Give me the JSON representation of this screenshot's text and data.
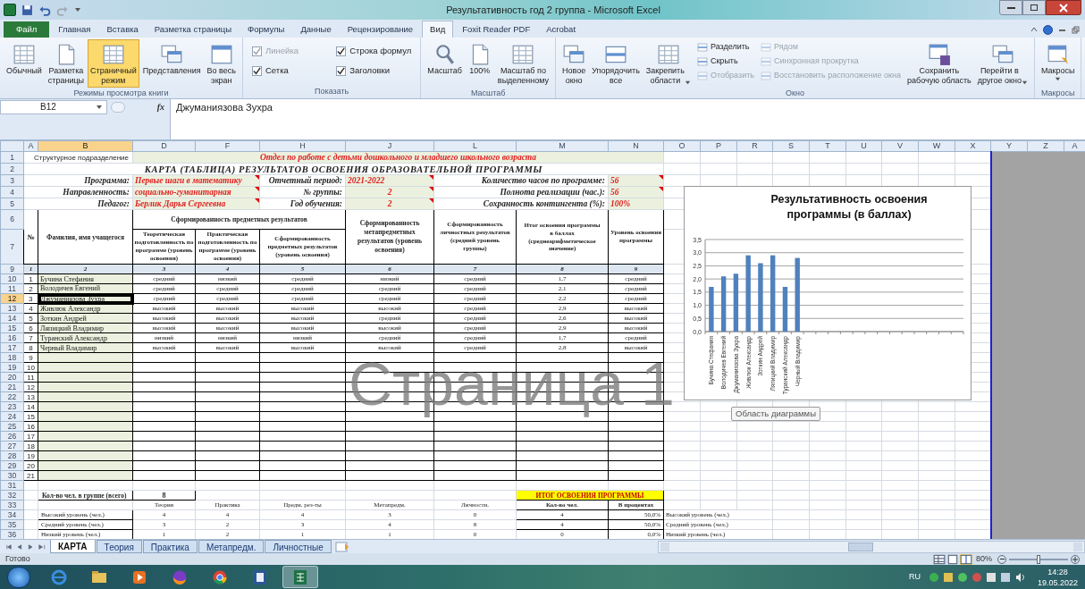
{
  "title_bar": {
    "title": "Результативность год 2 группа  -  Microsoft Excel"
  },
  "ribbon_tabs": [
    {
      "label": "Файл",
      "kind": "file",
      "selected": false
    },
    {
      "label": "Главная",
      "kind": "tab",
      "selected": false
    },
    {
      "label": "Вставка",
      "kind": "tab",
      "selected": false
    },
    {
      "label": "Разметка страницы",
      "kind": "tab",
      "selected": false
    },
    {
      "label": "Формулы",
      "kind": "tab",
      "selected": false
    },
    {
      "label": "Данные",
      "kind": "tab",
      "selected": false
    },
    {
      "label": "Рецензирование",
      "kind": "tab",
      "selected": false
    },
    {
      "label": "Вид",
      "kind": "tab",
      "selected": true
    },
    {
      "label": "Foxit Reader PDF",
      "kind": "tab",
      "selected": false
    },
    {
      "label": "Acrobat",
      "kind": "tab",
      "selected": false
    }
  ],
  "ribbon_groups": [
    {
      "label": "Режимы просмотра книги",
      "items": [
        {
          "kind": "large",
          "lines": [
            "Обычный"
          ],
          "selected": false,
          "disabled": false,
          "dropdown": false
        },
        {
          "kind": "large",
          "lines": [
            "Разметка",
            "страницы"
          ],
          "selected": false,
          "disabled": false,
          "dropdown": false
        },
        {
          "kind": "large",
          "lines": [
            "Страничный",
            "режим"
          ],
          "selected": true,
          "disabled": false,
          "dropdown": false
        },
        {
          "kind": "large",
          "lines": [
            "Представления"
          ],
          "selected": false,
          "disabled": false,
          "dropdown": false
        },
        {
          "kind": "large",
          "lines": [
            "Во весь",
            "экран"
          ],
          "selected": false,
          "disabled": false,
          "dropdown": false
        }
      ]
    },
    {
      "label": "Показать",
      "items": [
        {
          "kind": "check",
          "lines": [
            "Линейка"
          ],
          "checked": true,
          "disabled": true
        },
        {
          "kind": "check",
          "lines": [
            "Строка формул"
          ],
          "checked": true,
          "disabled": false
        },
        {
          "kind": "check",
          "lines": [
            "Сетка"
          ],
          "checked": true,
          "disabled": false
        },
        {
          "kind": "check",
          "lines": [
            "Заголовки"
          ],
          "checked": true,
          "disabled": false
        }
      ]
    },
    {
      "label": "Масштаб",
      "items": [
        {
          "kind": "large",
          "lines": [
            "Масштаб"
          ],
          "selected": false,
          "disabled": false,
          "dropdown": false
        },
        {
          "kind": "large",
          "lines": [
            "100%"
          ],
          "selected": false,
          "disabled": false,
          "dropdown": false
        },
        {
          "kind": "large",
          "lines": [
            "Масштаб по",
            "выделенному"
          ],
          "selected": false,
          "disabled": false,
          "dropdown": false
        }
      ]
    },
    {
      "label": "Окно",
      "items": [
        {
          "kind": "large",
          "lines": [
            "Новое",
            "окно"
          ],
          "selected": false,
          "disabled": false,
          "dropdown": false
        },
        {
          "kind": "large",
          "lines": [
            "Упорядочить",
            "все"
          ],
          "selected": false,
          "disabled": false,
          "dropdown": false
        },
        {
          "kind": "large",
          "lines": [
            "Закрепить",
            "области"
          ],
          "selected": false,
          "disabled": false,
          "dropdown": true
        },
        {
          "kind": "small",
          "lines": [
            "Разделить"
          ],
          "disabled": false
        },
        {
          "kind": "small",
          "lines": [
            "Скрыть"
          ],
          "disabled": false
        },
        {
          "kind": "small",
          "lines": [
            "Отобразить"
          ],
          "disabled": true
        },
        {
          "kind": "small",
          "lines": [
            "Рядом"
          ],
          "disabled": true
        },
        {
          "kind": "small",
          "lines": [
            "Синхронная прокрутка"
          ],
          "disabled": true
        },
        {
          "kind": "small",
          "lines": [
            "Восстановить расположение окна"
          ],
          "disabled": true
        },
        {
          "kind": "large",
          "lines": [
            "Сохранить",
            "рабочую область"
          ],
          "selected": false,
          "disabled": false,
          "dropdown": false
        },
        {
          "kind": "large",
          "lines": [
            "Перейти в",
            "другое окно"
          ],
          "selected": false,
          "disabled": false,
          "dropdown": true
        }
      ]
    },
    {
      "label": "Макросы",
      "items": [
        {
          "kind": "large",
          "lines": [
            "Макросы"
          ],
          "selected": false,
          "disabled": false,
          "dropdown": true
        }
      ]
    }
  ],
  "formula_bar": {
    "name_box": "B12",
    "fx_label": "fx",
    "formula": "Джуманиязова Зухра"
  },
  "columns": [
    {
      "label": "A",
      "selected": false
    },
    {
      "label": "B",
      "selected": true
    },
    {
      "label": "D",
      "selected": false
    },
    {
      "label": "F",
      "selected": false
    },
    {
      "label": "H",
      "selected": false
    },
    {
      "label": "J",
      "selected": false
    },
    {
      "label": "L",
      "selected": false
    },
    {
      "label": "M",
      "selected": false
    },
    {
      "label": "N",
      "selected": false
    },
    {
      "label": "O",
      "selected": false
    },
    {
      "label": "P",
      "selected": false
    },
    {
      "label": "R",
      "selected": false
    },
    {
      "label": "S",
      "selected": false
    },
    {
      "label": "T",
      "selected": false
    },
    {
      "label": "U",
      "selected": false
    },
    {
      "label": "V",
      "selected": false
    },
    {
      "label": "W",
      "selected": false
    },
    {
      "label": "X",
      "selected": false
    },
    {
      "label": "Y",
      "selected": false
    },
    {
      "label": "Z",
      "selected": false
    },
    {
      "label": "A",
      "selected": false
    }
  ],
  "row_headers": [
    {
      "label": "1",
      "selected": false
    },
    {
      "label": "2",
      "selected": false
    },
    {
      "label": "3",
      "selected": false
    },
    {
      "label": "4",
      "selected": false
    },
    {
      "label": "5",
      "selected": false
    },
    {
      "label": "6",
      "selected": false
    },
    {
      "label": "7",
      "selected": false
    },
    {
      "label": "9",
      "selected": false
    },
    {
      "label": "10",
      "selected": false
    },
    {
      "label": "11",
      "selected": false
    },
    {
      "label": "12",
      "selected": true
    },
    {
      "label": "13",
      "selected": false
    },
    {
      "label": "14",
      "selected": false
    },
    {
      "label": "15",
      "selected": false
    },
    {
      "label": "16",
      "selected": false
    },
    {
      "label": "17",
      "selected": false
    },
    {
      "label": "18",
      "selected": false
    },
    {
      "label": "19",
      "selected": false
    },
    {
      "label": "20",
      "selected": false
    },
    {
      "label": "21",
      "selected": false
    },
    {
      "label": "22",
      "selected": false
    },
    {
      "label": "23",
      "selected": false
    },
    {
      "label": "24",
      "selected": false
    },
    {
      "label": "25",
      "selected": false
    },
    {
      "label": "26",
      "selected": false
    },
    {
      "label": "27",
      "selected": false
    },
    {
      "label": "28",
      "selected": false
    },
    {
      "label": "29",
      "selected": false
    },
    {
      "label": "30",
      "selected": false
    },
    {
      "label": "31",
      "selected": false
    },
    {
      "label": "32",
      "selected": false
    },
    {
      "label": "33",
      "selected": false
    },
    {
      "label": "34",
      "selected": false
    },
    {
      "label": "35",
      "selected": false
    },
    {
      "label": "36",
      "selected": false
    }
  ],
  "sheet": {
    "department_label": "Структурное подразделение",
    "department": "Отдел по работе с детьми дошкольного и младшего школьного возраста",
    "title": "КАРТА (ТАБЛИЦА) РЕЗУЛЬТАТОВ ОСВОЕНИЯ ОБРАЗОВАТЕЛЬНОЙ ПРОГРАММЫ",
    "info_rows": [
      [
        {
          "label": "Программа:",
          "value": "Первые шаги в математику",
          "comment": true
        },
        {
          "label": "Отчетный период:",
          "value": "2021-2022",
          "comment": true
        },
        {
          "label": "Количество часов по программе:",
          "value": "56",
          "comment": true
        }
      ],
      [
        {
          "label": "Направленность:",
          "value": "социально-гуманитарная",
          "comment": true
        },
        {
          "label": "№ группы:",
          "value": "2",
          "comment": true
        },
        {
          "label": "Полнота реализации (час.):",
          "value": "56",
          "comment": true
        }
      ],
      [
        {
          "label": "Педагог:",
          "value": "Берлик Дарья Сергеевна",
          "comment": true
        },
        {
          "label": "Год обучения:",
          "value": "2",
          "comment": true
        },
        {
          "label": "Сохранность контингента (%):",
          "value": "100%",
          "comment": false
        }
      ]
    ],
    "table_header": {
      "number": "№",
      "name": "Фамилия, имя учащегося",
      "subject_group": "Сформированность предметных результатов",
      "theory": "Теоретическая подготовленность по программе (уровень освоения)",
      "practice": "Практическая подготовленность по программе (уровень освоения)",
      "subject": "Сформированность предметных результатов (уровень освоения)",
      "meta": "Сформированность метапредметных результатов (уровень освоения)",
      "personal": "Сформированность личностных результатов (средний уровень группы)",
      "total": "Итог освоения программы в баллах",
      "total_note": "(среднеарифметическое значение)",
      "level": "Уровень освоения программы"
    },
    "column_numbers": [
      "1",
      "2",
      "3",
      "4",
      "5",
      "6",
      "7",
      "8",
      "9"
    ],
    "students": [
      {
        "no": "1",
        "name": "Бучина Стефания",
        "theory": "средний",
        "practice": "низкий",
        "subject": "средний",
        "meta": "низкий",
        "personal": "средний",
        "score": "1,7",
        "level": "средний",
        "selected": false
      },
      {
        "no": "2",
        "name": "Володичев Евгений",
        "theory": "средний",
        "practice": "средний",
        "subject": "средний",
        "meta": "средний",
        "personal": "средний",
        "score": "2,1",
        "level": "средний",
        "selected": false
      },
      {
        "no": "3",
        "name": "Джуманиязова Зухра",
        "theory": "средний",
        "practice": "средний",
        "subject": "средний",
        "meta": "средний",
        "personal": "средний",
        "score": "2,2",
        "level": "средний",
        "selected": true
      },
      {
        "no": "4",
        "name": "Живлюк Александр",
        "theory": "высокий",
        "practice": "высокий",
        "subject": "высокий",
        "meta": "высокий",
        "personal": "средний",
        "score": "2,9",
        "level": "высокий",
        "selected": false
      },
      {
        "no": "5",
        "name": "Зоткин Андрей",
        "theory": "высокий",
        "practice": "высокий",
        "subject": "высокий",
        "meta": "средний",
        "personal": "средний",
        "score": "2,6",
        "level": "высокий",
        "selected": false
      },
      {
        "no": "6",
        "name": "Ляпицкий Владимир",
        "theory": "высокий",
        "practice": "высокий",
        "subject": "высокий",
        "meta": "высокий",
        "personal": "средний",
        "score": "2,9",
        "level": "высокий",
        "selected": false
      },
      {
        "no": "7",
        "name": "Туранский Александр",
        "theory": "низкий",
        "practice": "низкий",
        "subject": "низкий",
        "meta": "средний",
        "personal": "средний",
        "score": "1,7",
        "level": "средний",
        "selected": false
      },
      {
        "no": "8",
        "name": "Черный Владимир",
        "theory": "высокий",
        "practice": "высокий",
        "subject": "высокий",
        "meta": "высокий",
        "personal": "средний",
        "score": "2,8",
        "level": "высокий",
        "selected": false
      }
    ],
    "empty_rows": [
      "9",
      "10",
      "11",
      "12",
      "13",
      "14",
      "15",
      "16",
      "17",
      "18",
      "19",
      "20",
      "21"
    ],
    "summary": {
      "group_size_label": "Кол-во чел. в группе (всего)",
      "group_size": "8",
      "result_title": "ИТОГ ОСВОЕНИЯ ПРОГРАММЫ",
      "headers": [
        "Теория",
        "Практика",
        "Предм. рез-ты",
        "Метапредм.",
        "Личностн.",
        "Кол-во чел.",
        "В процентах"
      ],
      "rows": [
        {
          "label": "Высокий уровень (чел.)",
          "values": [
            "4",
            "4",
            "4",
            "3",
            "0"
          ],
          "count": "4",
          "percent": "50,0%",
          "side_label": "Высокий уровень (чел.)"
        },
        {
          "label": "Средний уровень (чел.)",
          "values": [
            "3",
            "2",
            "3",
            "4",
            "8"
          ],
          "count": "4",
          "percent": "50,0%",
          "side_label": "Средний уровень (чел.)"
        },
        {
          "label": "Низкий уровень (чел.)",
          "values": [
            "1",
            "2",
            "1",
            "1",
            "0"
          ],
          "count": "0",
          "percent": "0,0%",
          "side_label": "Низкий уровень (чел.)"
        }
      ]
    },
    "page_label": "Страница 1"
  },
  "chart": {
    "tooltip": "Область диаграммы",
    "chart_data": {
      "type": "bar",
      "title": "Результативность освоения программы (в баллах)",
      "categories": [
        "Бучина Стефания",
        "Володичев Евгений",
        "Джуманиязова Зухра",
        "Живлюк Александр",
        "Зоткин Андрей",
        "Ляпицкий Владимир",
        "Туранский Александр",
        "Черный Владимир"
      ],
      "values": [
        1.7,
        2.1,
        2.2,
        2.9,
        2.6,
        2.9,
        1.7,
        2.8
      ],
      "grid": true,
      "ylim": [
        0,
        3.5
      ],
      "yticks": [
        {
          "value": 0,
          "label": "0,0"
        },
        {
          "value": 0.5,
          "label": "0,5"
        },
        {
          "value": 1,
          "label": "1,0"
        },
        {
          "value": 1.5,
          "label": "1,5"
        },
        {
          "value": 2,
          "label": "2,0"
        },
        {
          "value": 2.5,
          "label": "2,5"
        },
        {
          "value": 3,
          "label": "3,0"
        },
        {
          "value": 3.5,
          "label": "3,5"
        }
      ]
    }
  },
  "sheet_tabs": [
    {
      "label": "КАРТА",
      "selected": true
    },
    {
      "label": "Теория",
      "selected": false
    },
    {
      "label": "Практика",
      "selected": false
    },
    {
      "label": "Метапредм.",
      "selected": false
    },
    {
      "label": "Личностные",
      "selected": false
    }
  ],
  "status_bar": {
    "status": "Готово",
    "views": [
      {
        "kind": "normal",
        "selected": false
      },
      {
        "kind": "layout",
        "selected": false
      },
      {
        "kind": "pagebreak",
        "selected": true
      }
    ],
    "zoom": {
      "label": "80%",
      "level": 0.5
    }
  },
  "taskbar": {
    "apps": [
      {
        "kind": "globe",
        "active": false
      },
      {
        "kind": "folder",
        "active": false
      },
      {
        "kind": "play",
        "active": false
      },
      {
        "kind": "fox",
        "active": false
      },
      {
        "kind": "wheel",
        "active": false
      },
      {
        "kind": "doc",
        "active": false
      },
      {
        "kind": "sheet",
        "active": true
      }
    ],
    "language": "RU",
    "time": "14:28",
    "date": "19.05.2022"
  }
}
